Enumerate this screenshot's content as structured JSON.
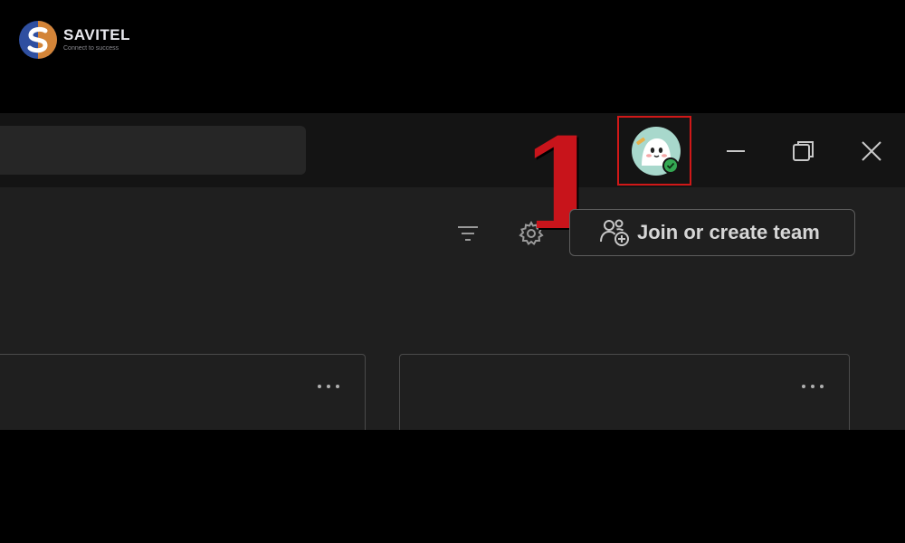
{
  "brand": {
    "name": "SAVITEL",
    "tagline": "Connect to success",
    "colors": {
      "blue": "#2f4fa0",
      "orange": "#e58a2c"
    }
  },
  "titlebar": {
    "search_placeholder": "",
    "avatar_status": "available",
    "window_controls": [
      "minimize-icon",
      "restore-icon",
      "close-icon"
    ]
  },
  "annotation": {
    "step": "1",
    "highlight_color": "#d01818"
  },
  "toolbar": {
    "filter_icon": "filter-icon",
    "settings_icon": "gear-icon",
    "join_button_label": "Join or create team",
    "join_button_icon": "people-add-icon"
  },
  "cards": [
    {
      "menu_icon": "more-options-icon"
    },
    {
      "menu_icon": "more-options-icon"
    }
  ],
  "colors": {
    "titlebar_bg": "#141414",
    "content_bg": "#1f1f1f",
    "status_green": "#34a853",
    "annotation_red": "#c8141b"
  }
}
